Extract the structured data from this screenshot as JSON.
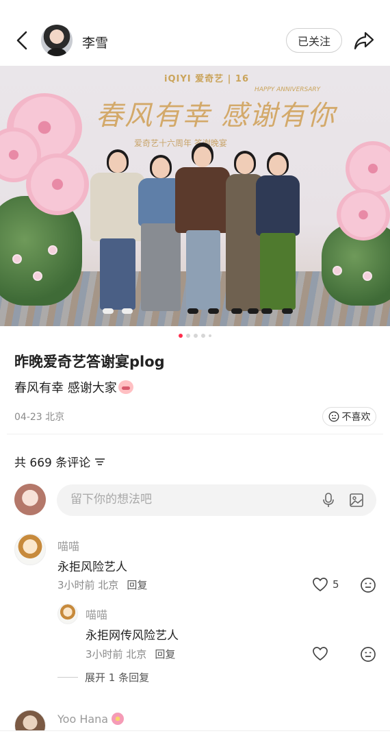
{
  "header": {
    "author": "李雪",
    "follow_label": "已关注"
  },
  "hero": {
    "brand": "iQIYI 爱奇艺 | 16",
    "anniversary": "HAPPY ANNIVERSARY",
    "slogan": "春风有幸 感谢有你",
    "subslogan": "爱奇艺十六周年 答谢晚宴",
    "image_count": 5,
    "active_index": 0
  },
  "post": {
    "title": "昨晚爱奇艺答谢宴plog",
    "desc": "春风有幸 感谢大家",
    "meta": "04-23 北京",
    "dislike_label": "不喜欢"
  },
  "comments_header": {
    "label": "共 669 条评论"
  },
  "comment_input": {
    "placeholder": "留下你的想法吧"
  },
  "comments": [
    {
      "name": "喵喵",
      "text": "永拒风险艺人",
      "meta": "3小时前 北京",
      "reply": "回复",
      "likes": "5"
    },
    {
      "name": "喵喵",
      "text": "永拒网传风险艺人",
      "meta": "3小时前 北京",
      "reply": "回复",
      "likes": ""
    }
  ],
  "expand_label": "展开 1 条回复",
  "next_comment": {
    "name": "Yoo Hana"
  },
  "colors": {
    "accent": "#ff2e4d",
    "text": "#222222",
    "muted": "#8a8a8a"
  }
}
